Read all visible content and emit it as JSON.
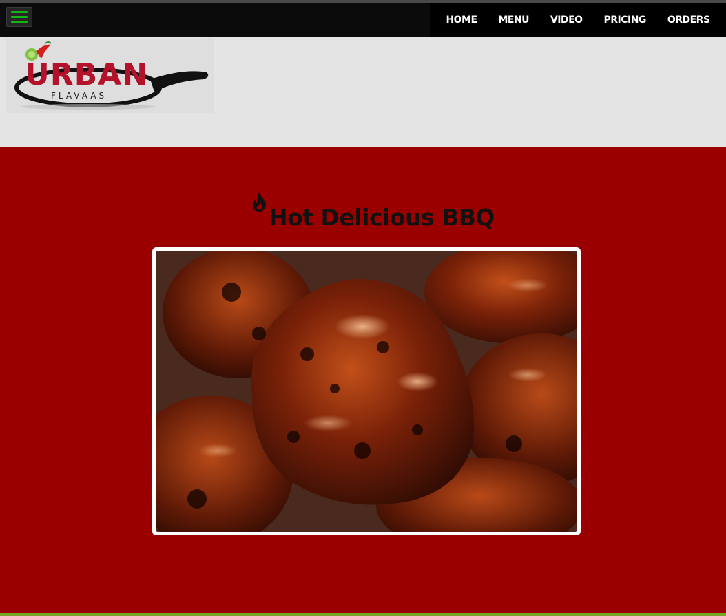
{
  "nav": {
    "items": [
      {
        "label": "HOME"
      },
      {
        "label": "MENU"
      },
      {
        "label": "VIDEO"
      },
      {
        "label": "PRICING"
      },
      {
        "label": "ORDERS"
      }
    ]
  },
  "logo": {
    "wordmark": "URBAN",
    "subtitle": "FLAVAAS"
  },
  "hero": {
    "title": "Hot Delicious BBQ",
    "icon": "fire-icon"
  },
  "colors": {
    "main_background": "#9a0000",
    "header_background": "#e4e4e4",
    "topbar": "#0b0b0b",
    "menu_toggle_bars": "#15b515",
    "logo_red": "#b3122a"
  }
}
